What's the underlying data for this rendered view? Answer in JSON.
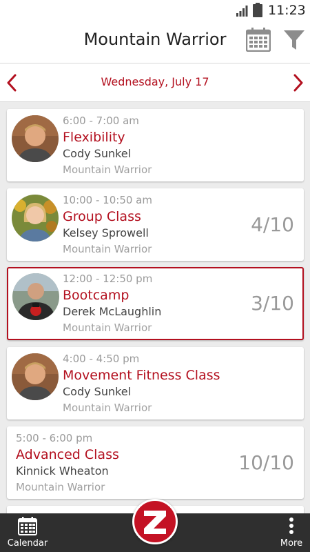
{
  "status_bar": {
    "time": "11:23"
  },
  "header": {
    "title": "Mountain Warrior"
  },
  "date_bar": {
    "date": "Wednesday, July 17"
  },
  "classes": [
    {
      "time": "6:00 - 7:00 am",
      "name": "Flexibility",
      "instructor": "Cody Sunkel",
      "location": "Mountain Warrior",
      "count": ""
    },
    {
      "time": "10:00 - 10:50 am",
      "name": "Group Class",
      "instructor": "Kelsey Sprowell",
      "location": "Mountain Warrior",
      "count": "4/10"
    },
    {
      "time": "12:00 - 12:50 pm",
      "name": "Bootcamp",
      "instructor": "Derek McLaughlin",
      "location": "Mountain Warrior",
      "count": "3/10"
    },
    {
      "time": "4:00 - 4:50 pm",
      "name": "Movement Fitness Class",
      "instructor": "Cody Sunkel",
      "location": "Mountain Warrior",
      "count": ""
    },
    {
      "time": "5:00 - 6:00 pm",
      "name": "Advanced Class",
      "instructor": "Kinnick Wheaton",
      "location": "Mountain Warrior",
      "count": "10/10"
    }
  ],
  "bottom_nav": {
    "calendar_label": "Calendar",
    "more_label": "More"
  },
  "colors": {
    "accent": "#b3101f",
    "nav_bg": "#2f2f2f"
  }
}
